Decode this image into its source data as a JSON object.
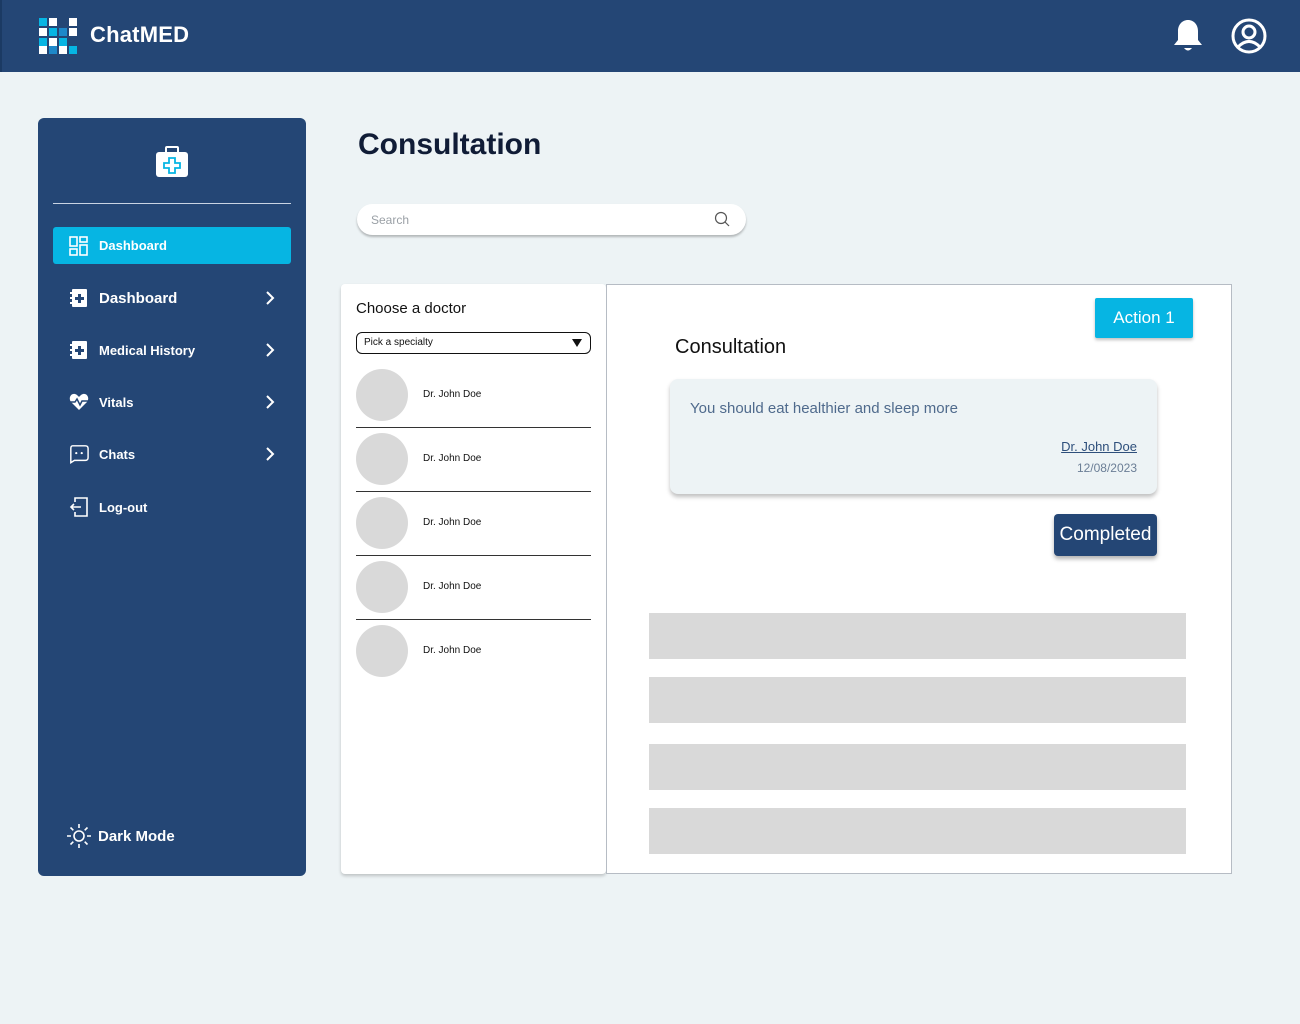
{
  "app": {
    "brand": "ChatMED"
  },
  "header": {
    "icons": [
      "bell-icon",
      "user-circle-icon"
    ]
  },
  "sidebar": {
    "logo_icon": "first-aid-kit-icon",
    "items": [
      {
        "label": "Dashboard",
        "icon": "grid-icon",
        "active": true
      },
      {
        "label": "Dashboard",
        "icon": "medical-record-icon",
        "chevron": true
      },
      {
        "label": "Medical History",
        "icon": "medical-record-icon",
        "chevron": true
      },
      {
        "label": "Vitals",
        "icon": "heartbeat-icon",
        "chevron": true
      },
      {
        "label": "Chats",
        "icon": "chat-bubble-icon",
        "chevron": true
      },
      {
        "label": "Log-out",
        "icon": "logout-icon"
      }
    ],
    "dark_mode": {
      "label": "Dark Mode",
      "icon": "sun-icon"
    }
  },
  "main": {
    "title": "Consultation",
    "search": {
      "placeholder": "Search",
      "value": ""
    }
  },
  "doctor_panel": {
    "title": "Choose a doctor",
    "specialty_select": {
      "selected": "Pick a specialty"
    },
    "doctors": [
      {
        "name": "Dr. John Doe"
      },
      {
        "name": "Dr. John Doe"
      },
      {
        "name": "Dr. John Doe"
      },
      {
        "name": "Dr. John Doe"
      },
      {
        "name": "Dr. John Doe"
      }
    ]
  },
  "consultation_panel": {
    "action_label": "Action 1",
    "title": "Consultation",
    "message": {
      "text": "You should eat healthier and sleep more",
      "doctor": "Dr. John Doe",
      "date": "12/08/2023"
    },
    "completed_label": "Completed"
  },
  "colors": {
    "primary": "#244675",
    "accent": "#06b5e3",
    "background": "#edf3f5",
    "placeholder": "#d9d9d9"
  }
}
